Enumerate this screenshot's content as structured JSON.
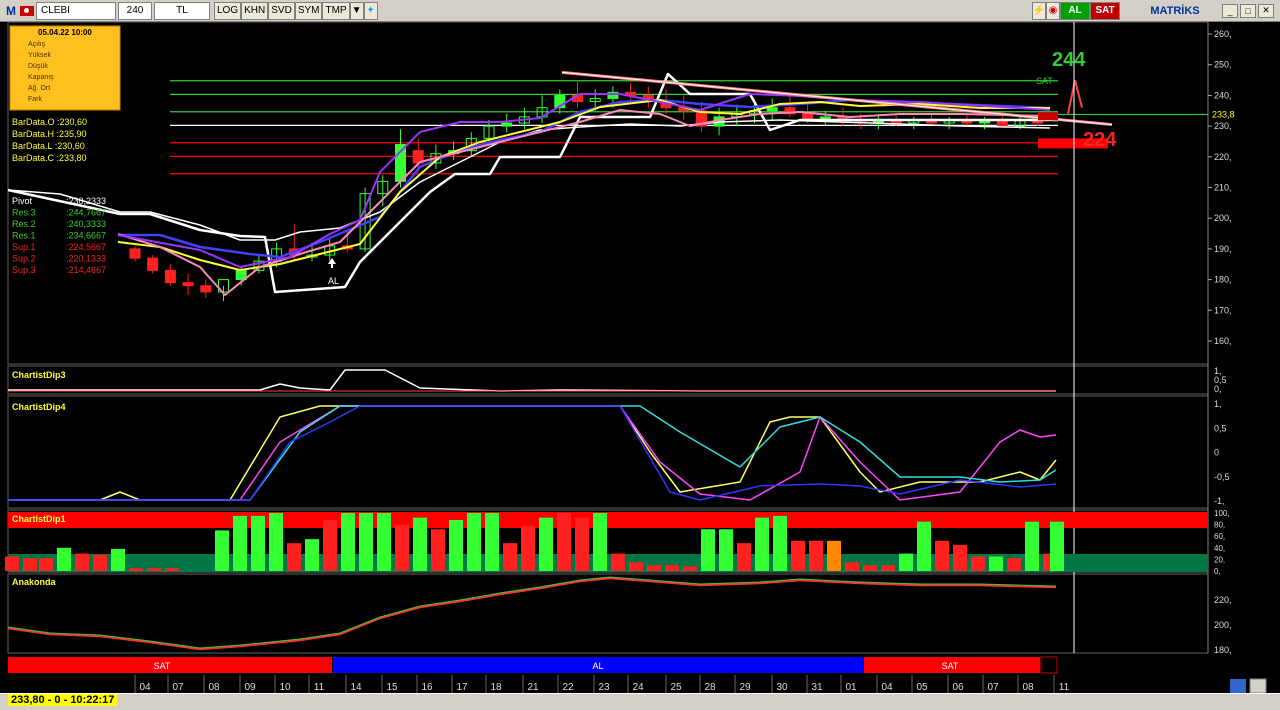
{
  "toolbar": {
    "logo": "M",
    "symbol": "CLEBI",
    "period": "240",
    "currency": "TL",
    "buttons": [
      "LOG",
      "KHN",
      "SVD",
      "SYM",
      "TMP"
    ],
    "al_label": "AL",
    "sat_label": "SAT",
    "brand": "MATRİKS"
  },
  "info_box": {
    "date": "05.04.22 10:00",
    "rows": [
      "Açılış",
      "Yüksek",
      "Düşük",
      "Kapanış",
      "Ağ. Ort",
      "Fark"
    ]
  },
  "bardata": [
    "BarData.O :230,60",
    "BarData.H :235,90",
    "BarData.L :230,60",
    "BarData.C :233,80"
  ],
  "pivots": [
    {
      "label": "Pivot",
      "value": ":230,2333",
      "color": "#ffffff"
    },
    {
      "label": "Res.3",
      "value": ":244,7667",
      "color": "#33cc33"
    },
    {
      "label": "Res.2",
      "value": ":240,3333",
      "color": "#33cc33"
    },
    {
      "label": "Res.1",
      "value": ":234,6667",
      "color": "#33cc33"
    },
    {
      "label": "Sup.1",
      "value": ":224,5667",
      "color": "#ff2020"
    },
    {
      "label": "Sup.2",
      "value": ":220,1333",
      "color": "#ff2020"
    },
    {
      "label": "Sup.3",
      "value": ":214,4667",
      "color": "#ff2020"
    }
  ],
  "annotations": {
    "target_up": "244",
    "target_down": "224",
    "sat_marker": "SAT",
    "al_marker": "AL",
    "last_price": "233,8"
  },
  "price_axis": [
    "260,",
    "250,",
    "240,",
    "230,",
    "220,",
    "210,",
    "200,",
    "190,",
    "180,",
    "170,",
    "160,"
  ],
  "panels": {
    "dip3": {
      "title": "ChartistDip3",
      "axis": [
        "1,",
        "0,5",
        "0,"
      ]
    },
    "dip4": {
      "title": "ChartistDip4",
      "axis": [
        "1,",
        "0,5",
        "0",
        "-0,5",
        "-1,"
      ]
    },
    "dip1": {
      "title": "ChartistDip1",
      "axis": [
        "100,",
        "80,",
        "60,",
        "40,",
        "20,",
        "0,"
      ]
    },
    "anakonda": {
      "title": "Anakonda",
      "axis": [
        "220,",
        "200,",
        "180,"
      ]
    }
  },
  "signal_bar": [
    {
      "label": "SAT",
      "color": "#ff0000"
    },
    {
      "label": "AL",
      "color": "#0000ff"
    },
    {
      "label": "SAT",
      "color": "#ff0000"
    }
  ],
  "date_axis": [
    "04",
    "07",
    "08",
    "09",
    "10",
    "11",
    "14",
    "15",
    "16",
    "17",
    "18",
    "21",
    "22",
    "23",
    "24",
    "25",
    "28",
    "29",
    "30",
    "31",
    "01",
    "04",
    "05",
    "06",
    "07",
    "08",
    "11"
  ],
  "status": {
    "text": "233,80 - 0 - 10:22:17"
  },
  "colors": {
    "background": "#000000",
    "up": "#33ff33",
    "down": "#ff2020",
    "resistance": "#33cc33",
    "support": "#ff0000"
  }
}
